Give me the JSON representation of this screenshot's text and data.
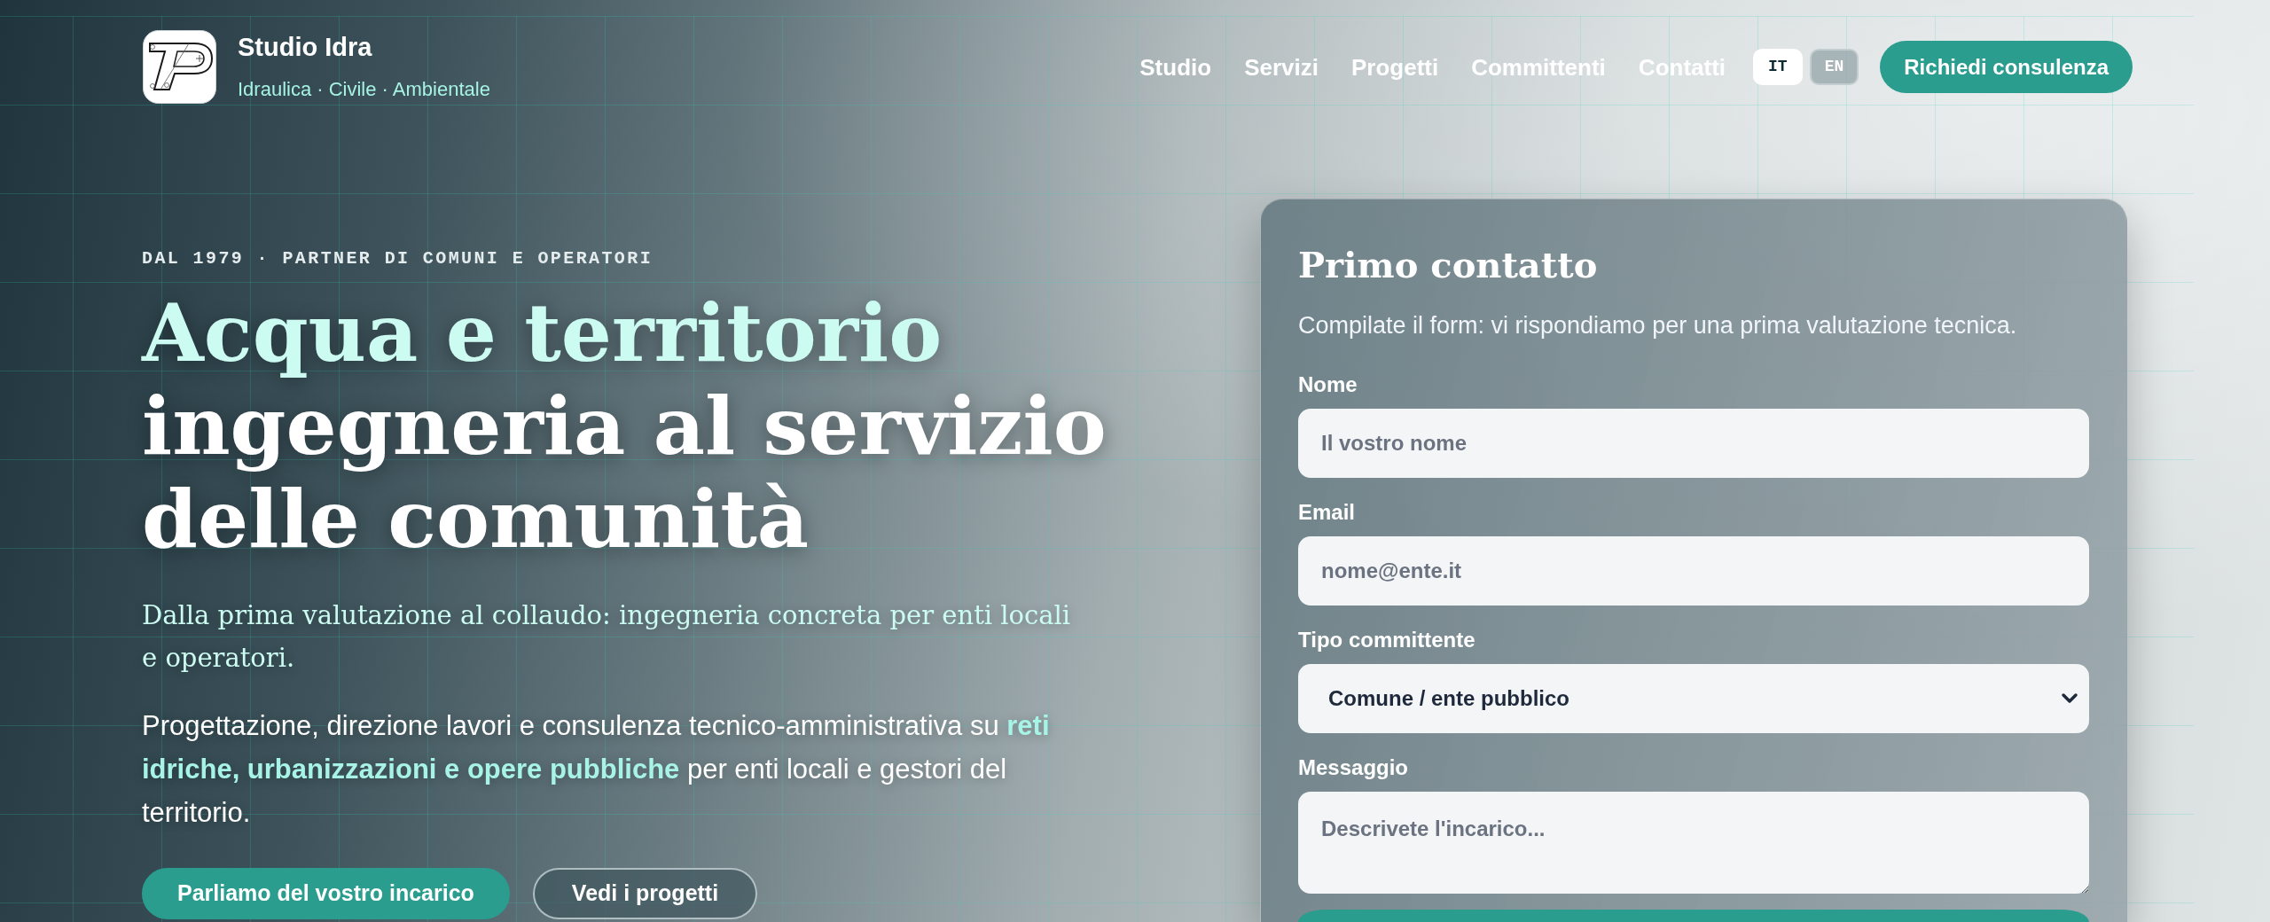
{
  "brand": {
    "name": "Studio Idra",
    "tagline": "Idraulica · Civile · Ambientale"
  },
  "nav": {
    "links": [
      "Studio",
      "Servizi",
      "Progetti",
      "Committenti",
      "Contatti"
    ],
    "languages": [
      {
        "label": "IT",
        "selected": true
      },
      {
        "label": "EN",
        "selected": false
      }
    ],
    "cta": "Richiedi consulenza"
  },
  "hero": {
    "eyebrow": "DAL 1979 · PARTNER DI COMUNI E OPERATORI",
    "heading": {
      "accent": "Acqua e territorio",
      "text": "ingegneria al servizio delle comunità"
    },
    "lead": "Dalla prima valutazione al collaudo: ingegneria concreta per enti locali e operatori.",
    "body": "Progettazione, direzione lavori e consulenza tecnico-amministrativa su **reti idriche, urbanizzazioni e opere pubbliche** per enti locali e gestori del territorio.",
    "buttons": [
      {
        "label": "Parliamo del vostro incarico",
        "kind": "primary"
      },
      {
        "label": "Vedi i progetti",
        "kind": "secondary"
      }
    ]
  },
  "contact_form": {
    "title": "Primo contatto",
    "description": "Compilate il form: vi rispondiamo per una prima valutazione tecnica.",
    "fields": [
      {
        "kind": "input",
        "label": "Nome",
        "placeholder": "Il vostro nome"
      },
      {
        "kind": "input",
        "label": "Email",
        "placeholder": "nome@ente.it"
      },
      {
        "kind": "select",
        "label": "Tipo committente",
        "value": "Comune / ente pubblico"
      },
      {
        "kind": "textarea",
        "label": "Messaggio",
        "placeholder": "Descrivete l'incarico..."
      }
    ]
  }
}
